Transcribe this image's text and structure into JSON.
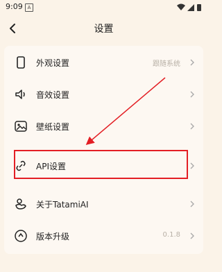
{
  "status": {
    "time": "9:09",
    "notification": "A"
  },
  "header": {
    "title": "设置"
  },
  "settings": [
    {
      "label": "外观设置",
      "value": "跟随系统",
      "icon": "phone-icon"
    },
    {
      "label": "音效设置",
      "value": "",
      "icon": "speaker-icon"
    },
    {
      "label": "壁纸设置",
      "value": "",
      "icon": "wallpaper-icon"
    },
    {
      "label": "API设置",
      "value": "",
      "icon": "link-icon"
    },
    {
      "label": "关于TatamiAI",
      "value": "",
      "icon": "duck-icon"
    },
    {
      "label": "版本升级",
      "value": "0.1.8",
      "icon": "upgrade-icon"
    }
  ],
  "colors": {
    "background": "#fbf3e8",
    "annotation": "#e31e24",
    "muted": "#b8b0a6"
  }
}
